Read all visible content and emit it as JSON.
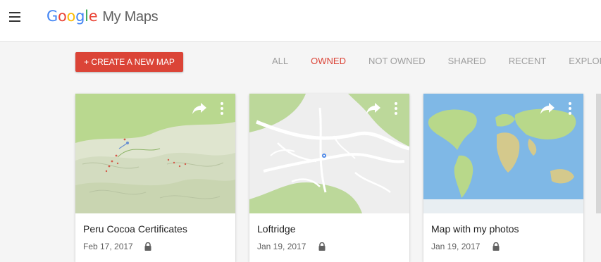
{
  "header": {
    "menu_icon": "hamburger-menu-icon",
    "logo": {
      "letters": [
        {
          "ch": "G",
          "color": "#4285F4"
        },
        {
          "ch": "o",
          "color": "#EA4335"
        },
        {
          "ch": "o",
          "color": "#FBBC05"
        },
        {
          "ch": "g",
          "color": "#4285F4"
        },
        {
          "ch": "l",
          "color": "#34A853"
        },
        {
          "ch": "e",
          "color": "#EA4335"
        }
      ],
      "product": "My Maps"
    }
  },
  "toolbar": {
    "create_label": "+ CREATE A NEW MAP",
    "tabs": [
      {
        "label": "ALL",
        "active": false
      },
      {
        "label": "OWNED",
        "active": true
      },
      {
        "label": "NOT OWNED",
        "active": false
      },
      {
        "label": "SHARED",
        "active": false
      },
      {
        "label": "RECENT",
        "active": false
      },
      {
        "label": "EXPLORE",
        "active": false
      }
    ]
  },
  "maps": [
    {
      "title": "Peru Cocoa Certificates",
      "date": "Feb 17, 2017",
      "thumbnail": "terrain-map",
      "icons": [
        "share-icon",
        "more-vert-icon",
        "lock-icon"
      ]
    },
    {
      "title": "Loftridge",
      "date": "Jan 19, 2017",
      "thumbnail": "street-map",
      "icons": [
        "share-icon",
        "more-vert-icon",
        "lock-icon"
      ]
    },
    {
      "title": "Map with my photos",
      "date": "Jan 19, 2017",
      "thumbnail": "world-map",
      "icons": [
        "share-icon",
        "more-vert-icon",
        "lock-icon"
      ]
    }
  ],
  "colors": {
    "accent": "#db4437",
    "tab_inactive": "#9e9e9e",
    "toolbar_bg": "#f5f5f5"
  }
}
